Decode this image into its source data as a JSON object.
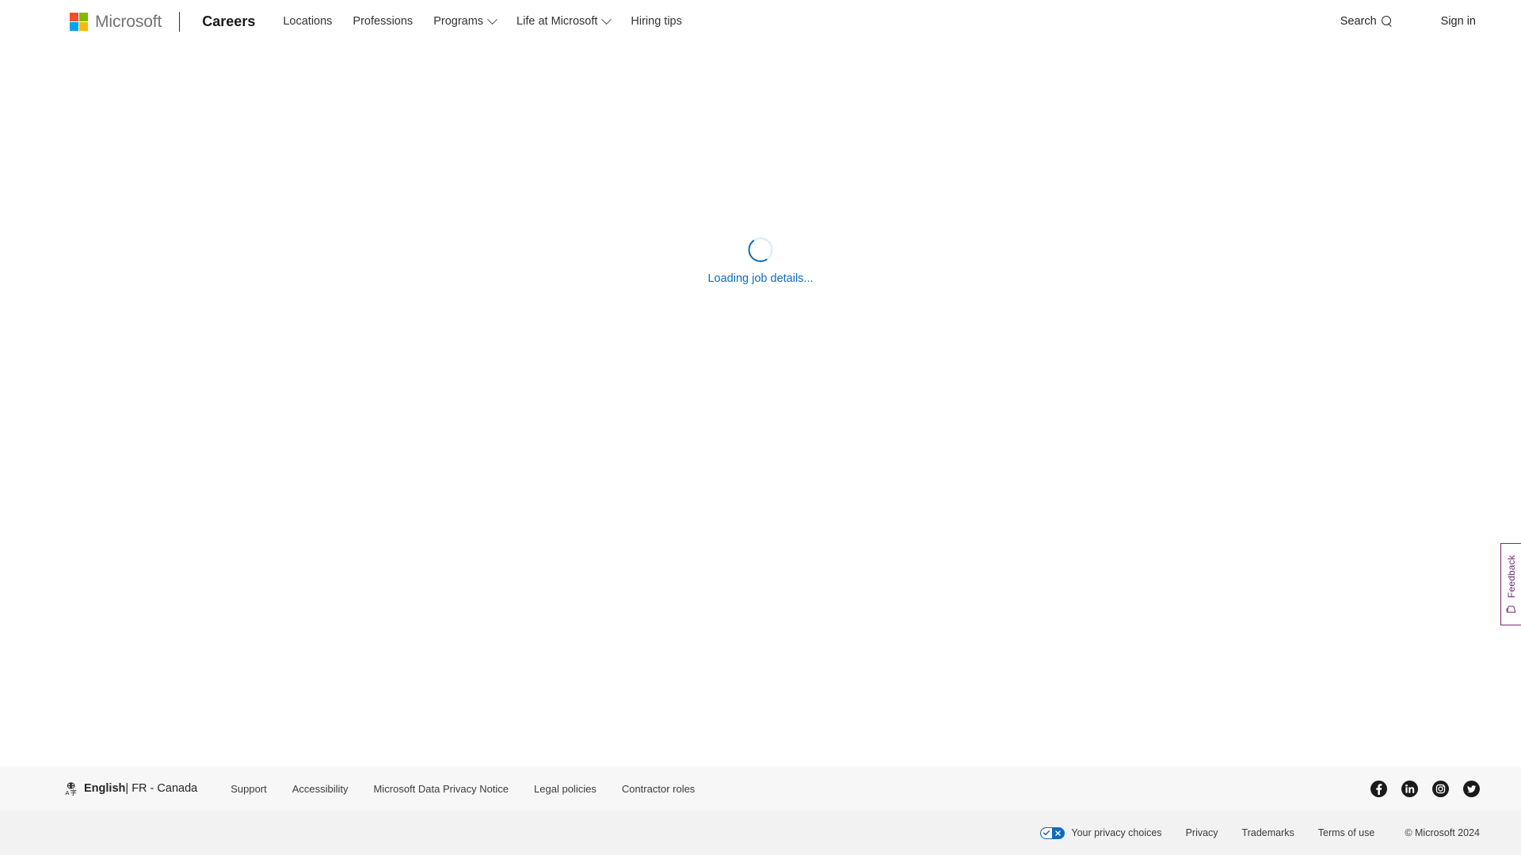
{
  "header": {
    "logo_name": "microsoft-logo",
    "wordmark": "Microsoft",
    "brand_title": "Careers",
    "nav_items": [
      {
        "label": "Locations",
        "has_chevron": false
      },
      {
        "label": "Professions",
        "has_chevron": false
      },
      {
        "label": "Programs",
        "has_chevron": true
      },
      {
        "label": "Life at Microsoft",
        "has_chevron": true
      },
      {
        "label": "Hiring tips",
        "has_chevron": false
      }
    ],
    "search_label": "Search",
    "signin_label": "Sign in"
  },
  "main": {
    "loading_text": "Loading job details...",
    "spinner_color": "#0f6cbd",
    "spinner_track_color": "#dbe9f8"
  },
  "feedback": {
    "label": "Feedback",
    "accent_color": "#742774"
  },
  "footer": {
    "language": {
      "icon": "language-globe-icon",
      "language_label": "English",
      "separator": "|",
      "region_label": "FR - Canada"
    },
    "links": [
      "Support",
      "Accessibility",
      "Microsoft Data Privacy Notice",
      "Legal policies",
      "Contractor roles"
    ],
    "socials": [
      "facebook-icon",
      "linkedin-icon",
      "instagram-icon",
      "twitter-icon"
    ],
    "legal": {
      "privacy_choices_label": "Your privacy choices",
      "links": [
        "Privacy",
        "Trademarks",
        "Terms of use"
      ],
      "copyright": "© Microsoft 2024"
    }
  },
  "colors": {
    "ms_red": "#F25022",
    "ms_green": "#7FBA00",
    "ms_blue": "#00A4EF",
    "ms_yellow": "#FFB900",
    "accent_blue": "#0f6cbd",
    "feedback_purple": "#742774"
  }
}
